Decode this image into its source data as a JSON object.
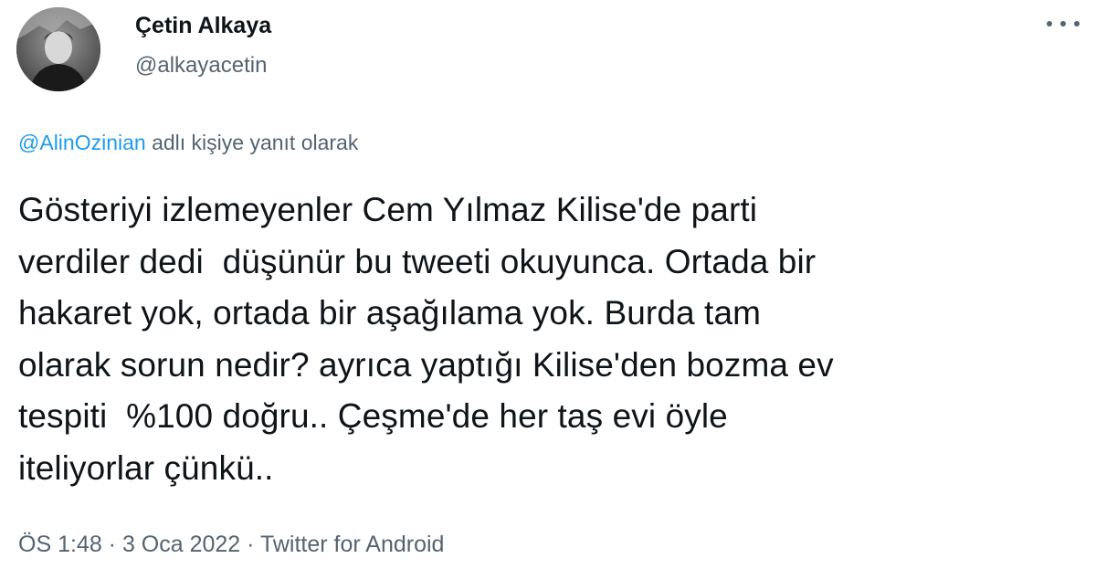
{
  "user": {
    "display_name": "Çetin Alkaya",
    "handle": "@alkayacetin"
  },
  "reply_context": {
    "mention": "@AlinOzinian",
    "suffix": " adlı kişiye yanıt olarak"
  },
  "tweet": {
    "lines": [
      "Gösteriyi izlemeyenler Cem Yılmaz Kilise'de parti",
      "verdiler dedi  düşünür bu tweeti okuyunca. Ortada bir",
      "hakaret yok, ortada bir aşağılama yok. Burda tam",
      "olarak sorun nedir? ayrıca yaptığı Kilise'den bozma ev",
      "tespiti  %100 doğru.. Çeşme'de her taş evi öyle",
      "iteliyorlar çünkü.."
    ]
  },
  "meta": {
    "time": "ÖS 1:48",
    "separator": " · ",
    "date": "3 Oca 2022",
    "source": "Twitter for Android"
  },
  "icons": {
    "more": "more-options-icon"
  },
  "colors": {
    "text": "#0f1419",
    "secondary": "#536471",
    "link": "#1d9bf0"
  }
}
